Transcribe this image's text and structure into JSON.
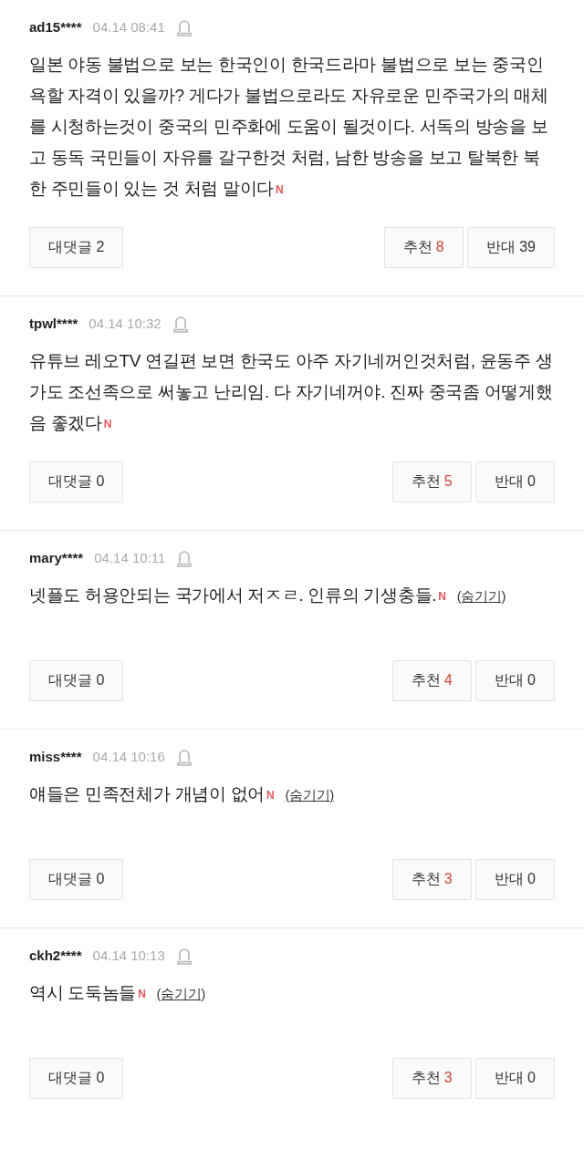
{
  "comments": [
    {
      "user": "ad15****",
      "time": "04.14 08:41",
      "text": "일본 야동 불법으로 보는 한국인이 한국드라마 불법으로 보는 중국인 욕할 자격이 있을까? 게다가 불법으로라도 자유로운 민주국가의 매체를 시청하는것이 중국의 민주화에 도움이 될것이다. 서독의 방송을 보고 동독 국민들이 자유를 갈구한것 처럼, 남한 방송을 보고 탈북한 북한 주민들이 있는 것 처럼 말이다",
      "badge": "N",
      "reply": "대댓글 2",
      "like_label": "추천",
      "like_count": "8",
      "dislike": "반대 39"
    },
    {
      "user": "tpwl****",
      "time": "04.14 10:32",
      "text": "유튜브 레오TV 연길편 보면 한국도 아주 자기네꺼인것처럼, 윤동주 생가도 조선족으로 써놓고 난리임. 다 자기네꺼야. 진짜 중국좀 어떻게했음 좋겠다",
      "badge": "N",
      "reply": "대댓글 0",
      "like_label": "추천",
      "like_count": "5",
      "dislike": "반대 0"
    },
    {
      "user": "mary****",
      "time": "04.14 10:11",
      "text": "넷플도 허용안되는 국가에서 저ㅈㄹ. 인류의 기생충들.",
      "badge": "N",
      "hide": "(숨기기)",
      "reply": "대댓글 0",
      "like_label": "추천",
      "like_count": "4",
      "dislike": "반대 0"
    },
    {
      "user": "miss****",
      "time": "04.14 10:16",
      "text": "얘들은 민족전체가 개념이 없어",
      "badge": "N",
      "hide": "(숨기기)",
      "reply": "대댓글 0",
      "like_label": "추천",
      "like_count": "3",
      "dislike": "반대 0"
    },
    {
      "user": "ckh2****",
      "time": "04.14 10:13",
      "text": "역시 도둑놈들",
      "badge": "N",
      "hide": "(숨기기)",
      "reply": "대댓글 0",
      "like_label": "추천",
      "like_count": "3",
      "dislike": "반대 0"
    }
  ]
}
